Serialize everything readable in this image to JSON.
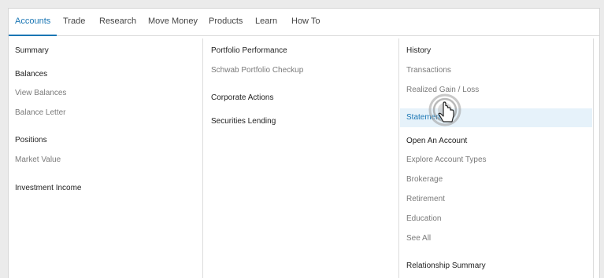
{
  "tabs": [
    {
      "label": "Accounts",
      "active": true
    },
    {
      "label": "Trade"
    },
    {
      "label": "Research"
    },
    {
      "label": "Move Money"
    },
    {
      "label": "Products"
    },
    {
      "label": "Learn"
    },
    {
      "label": "How To"
    }
  ],
  "col1": {
    "summary": "Summary",
    "balances": "Balances",
    "view_balances": "View Balances",
    "balance_letter": "Balance Letter",
    "positions": "Positions",
    "market_value": "Market Value",
    "investment_income": "Investment Income"
  },
  "col2": {
    "portfolio_performance": "Portfolio Performance",
    "portfolio_checkup": "Schwab Portfolio Checkup",
    "corporate_actions": "Corporate Actions",
    "securities_lending": "Securities Lending"
  },
  "col3": {
    "history": "History",
    "transactions": "Transactions",
    "realized_gain_loss": "Realized Gain / Loss",
    "statements": "Statements",
    "open_account": "Open An Account",
    "explore_account_types": "Explore Account Types",
    "brokerage": "Brokerage",
    "retirement": "Retirement",
    "education": "Education",
    "see_all": "See All",
    "relationship_summary": "Relationship Summary"
  },
  "colors": {
    "accent": "#1a76b4",
    "highlight": "#e6f2fa",
    "link_gray": "#7a7a7a"
  },
  "icons": {
    "cursor": "hand-pointer-icon"
  }
}
